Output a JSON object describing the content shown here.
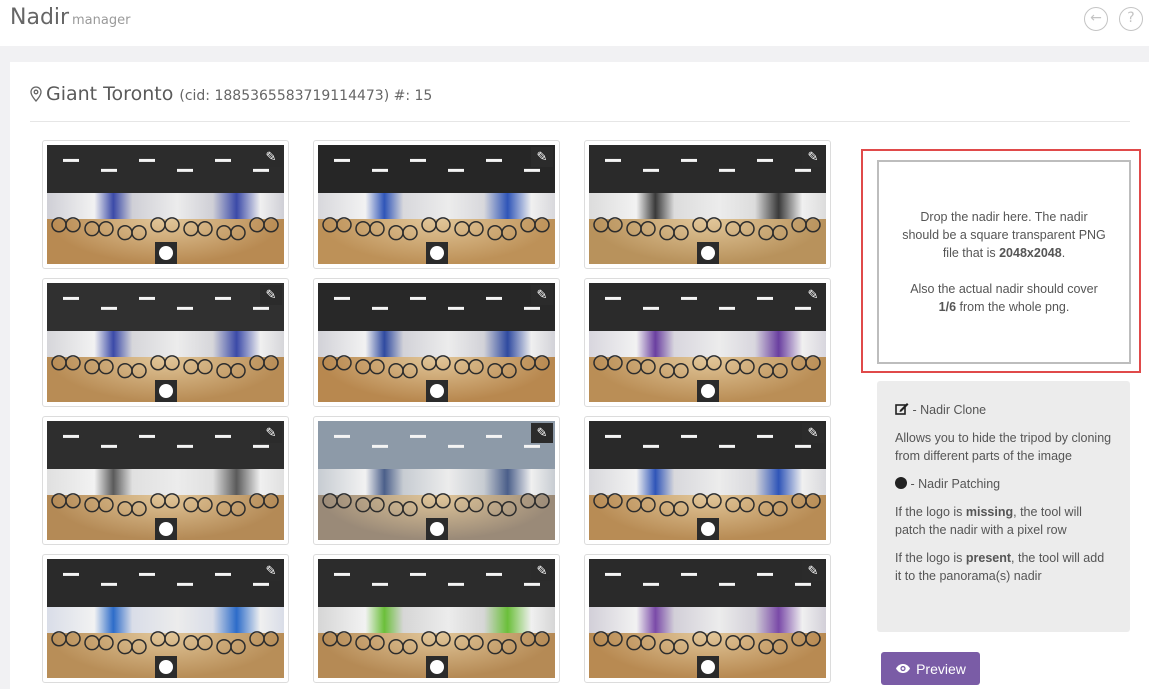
{
  "app": {
    "title": "Nadir",
    "subtitle": "manager"
  },
  "header_icons": [
    "back-icon",
    "help-icon"
  ],
  "location": {
    "name": "Giant Toronto",
    "meta": "(cid: 1885365583719114473) #: 15"
  },
  "dropzone": {
    "line1": "Drop the nadir here. The nadir should be a square transparent PNG file that is ",
    "size": "2048x2048",
    "line1_end": ".",
    "line2": "Also the actual nadir should cover ",
    "fraction": "1/6",
    "line2_end": " from the whole png."
  },
  "legend": {
    "clone_title": " - Nadir Clone",
    "clone_desc": "Allows you to hide the tripod by cloning from different parts of the image",
    "patch_title": " - Nadir Patching",
    "missing_pre": "If the logo is ",
    "missing_word": "missing",
    "missing_post": ", the tool will patch the nadir with a pixel row",
    "present_pre": "If the logo is ",
    "present_word": "present",
    "present_post": ", the tool will add it to the panorama(s) nadir"
  },
  "preview_button": "Preview",
  "thumbnails": [
    {
      "ceiling": "#2c2c2c",
      "wall": "#cfcfd6",
      "floor": "#b88a52",
      "accent": "#3b4aa8"
    },
    {
      "ceiling": "#262626",
      "wall": "#d8d8dc",
      "floor": "#bd9158",
      "accent": "#2f55b8"
    },
    {
      "ceiling": "#2a2a2a",
      "wall": "#dcdcdc",
      "floor": "#b8925c",
      "accent": "#3a3a3a"
    },
    {
      "ceiling": "#303030",
      "wall": "#d6d6da",
      "floor": "#b88c55",
      "accent": "#3b4aa8"
    },
    {
      "ceiling": "#282828",
      "wall": "#d2d2d8",
      "floor": "#b8884f",
      "accent": "#2f4aa0"
    },
    {
      "ceiling": "#2b2b2b",
      "wall": "#d8d6de",
      "floor": "#ba8e56",
      "accent": "#6a3fa0"
    },
    {
      "ceiling": "#2e2e2e",
      "wall": "#e0e0e0",
      "floor": "#b48a56",
      "accent": "#5a5a5a"
    },
    {
      "ceiling": "#8d9aa8",
      "wall": "#c7ccd2",
      "floor": "#9a8a78",
      "accent": "#4b5f8a"
    },
    {
      "ceiling": "#292929",
      "wall": "#d8d8dc",
      "floor": "#b88c55",
      "accent": "#2f55b8"
    },
    {
      "ceiling": "#2a2a2a",
      "wall": "#d9dde8",
      "floor": "#b88e58",
      "accent": "#2d6cc9"
    },
    {
      "ceiling": "#2c2c2c",
      "wall": "#d6d6d6",
      "floor": "#b58a55",
      "accent": "#6bbf3a"
    },
    {
      "ceiling": "#2a2a2a",
      "wall": "#d2cfd8",
      "floor": "#b88a52",
      "accent": "#7a4aa8"
    }
  ]
}
